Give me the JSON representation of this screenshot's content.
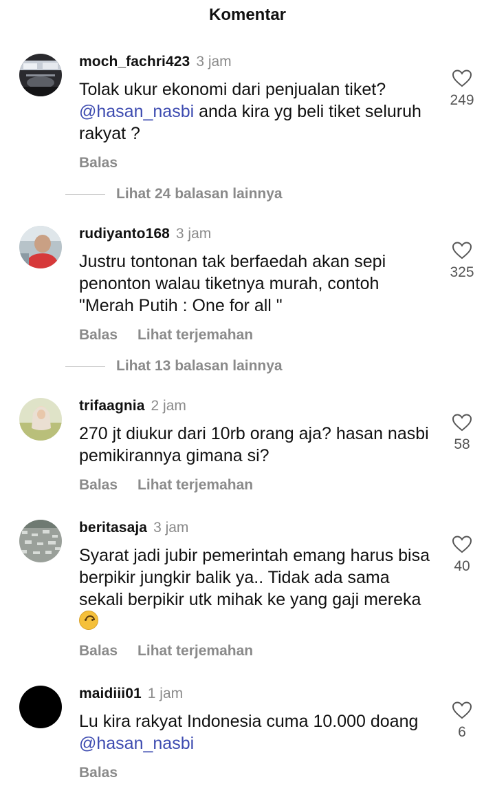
{
  "header": {
    "title": "Komentar"
  },
  "comments": [
    {
      "username": "moch_fachri423",
      "time": "3 jam",
      "text_parts": [
        "Tolak ukur ekonomi dari penjualan tiket?",
        "@hasan_nasbi",
        " anda kira yg beli tiket seluruh rakyat ?"
      ],
      "likes": "249",
      "reply_label": "Balas",
      "more_replies": "Lihat 24 balasan lainnya"
    },
    {
      "username": "rudiyanto168",
      "time": "3 jam",
      "text": "Justru tontonan tak berfaedah akan sepi penonton walau tiketnya murah, contoh \"Merah Putih : One for all \"",
      "likes": "325",
      "reply_label": "Balas",
      "translate_label": "Lihat terjemahan",
      "more_replies": "Lihat 13 balasan lainnya"
    },
    {
      "username": "trifaagnia",
      "time": "2 jam",
      "text": "270 jt diukur dari 10rb orang aja? hasan nasbi pemikirannya gimana si?",
      "likes": "58",
      "reply_label": "Balas",
      "translate_label": "Lihat terjemahan"
    },
    {
      "username": "beritasaja",
      "time": "3 jam",
      "text": "Syarat jadi jubir pemerintah emang harus bisa berpikir jungkir balik ya.. Tidak ada sama sekali berpikir utk mihak ke yang gaji mereka",
      "emoji": "upside-down-face-emoji",
      "likes": "40",
      "reply_label": "Balas",
      "translate_label": "Lihat terjemahan"
    },
    {
      "username": "maidiii01",
      "time": "1 jam",
      "text_parts": [
        "Lu kira rakyat Indonesia cuma 10.000 doang ",
        "@hasan_nasbi"
      ],
      "likes": "6",
      "reply_label": "Balas"
    }
  ],
  "colors": {
    "mention": "#3d4bb0",
    "muted": "#8a8a8a",
    "text": "#111111"
  },
  "icons": [
    "heart-outline-icon"
  ]
}
